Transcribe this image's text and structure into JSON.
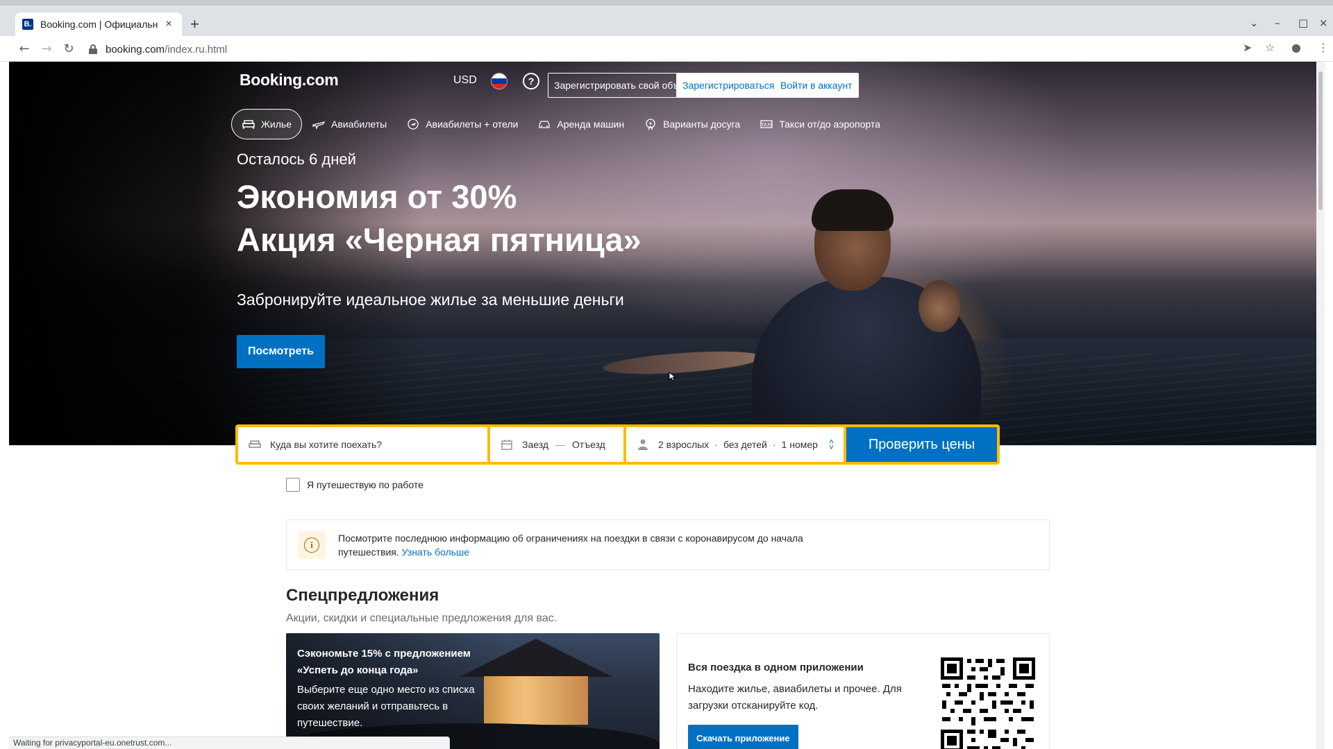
{
  "browser": {
    "tab_title": "Booking.com | Официальн",
    "tab_favicon": "B.",
    "tab_close": "×",
    "new_tab": "+",
    "url_host": "booking.com",
    "url_path": "/index.ru.html",
    "status_text": "Waiting for privacyportal-eu.onetrust.com..."
  },
  "header": {
    "logo": "Booking.com",
    "currency": "USD",
    "flag_colors": [
      "#ffffff",
      "#0039a6",
      "#d52b1e"
    ],
    "help": "?",
    "register_property": "Зарегистрировать свой объект",
    "register": "Зарегистрироваться",
    "sign_in": "Войти в аккаунт"
  },
  "nav": [
    {
      "label": "Жилье",
      "icon": "bed-icon",
      "active": true
    },
    {
      "label": "Авиабилеты",
      "icon": "plane-icon",
      "active": false
    },
    {
      "label": "Авиабилеты + отели",
      "icon": "flight-hotel-icon",
      "active": false
    },
    {
      "label": "Аренда машин",
      "icon": "car-icon",
      "active": false
    },
    {
      "label": "Варианты досуга",
      "icon": "attractions-icon",
      "active": false
    },
    {
      "label": "Такси от/до аэропорта",
      "icon": "taxi-icon",
      "active": false
    }
  ],
  "hero": {
    "kicker": "Осталось 6 дней",
    "headline_1": "Экономия от 30%",
    "headline_2": "Акция «Черная пятница»",
    "subline": "Забронируйте идеальное жилье за меньшие деньги",
    "cta": "Посмотреть"
  },
  "search": {
    "destination_placeholder": "Куда вы хотите поехать?",
    "checkin": "Заезд",
    "dash": "—",
    "checkout": "Отъезд",
    "adults": "2 взрослых",
    "children": "без детей",
    "rooms": "1 номер",
    "separator": "·",
    "submit": "Проверить цены",
    "business_travel": "Я путешествую по работе"
  },
  "notice": {
    "icon": "i",
    "text": "Посмотрите последнюю информацию об ограничениях на поездки в связи с коронавирусом до начала путешествия.",
    "link": "Узнать больше"
  },
  "offers": {
    "title": "Спецпредложения",
    "subtitle": "Акции, скидки и специальные предложения для вас.",
    "promo_title": "Сэкономьте 15% с предложением «Успеть до конца года»",
    "promo_text": "Выберите еще одно место из списка своих желаний и отправьтесь в путешествие.",
    "app_title": "Вся поездка в одном приложении",
    "app_text": "Находите жилье, авиабилеты и прочее. Для загрузки отсканируйте код.",
    "app_button": "Скачать приложение",
    "next": "›"
  },
  "colors": {
    "brand_blue": "#0071c2",
    "search_yellow": "#febb02"
  }
}
